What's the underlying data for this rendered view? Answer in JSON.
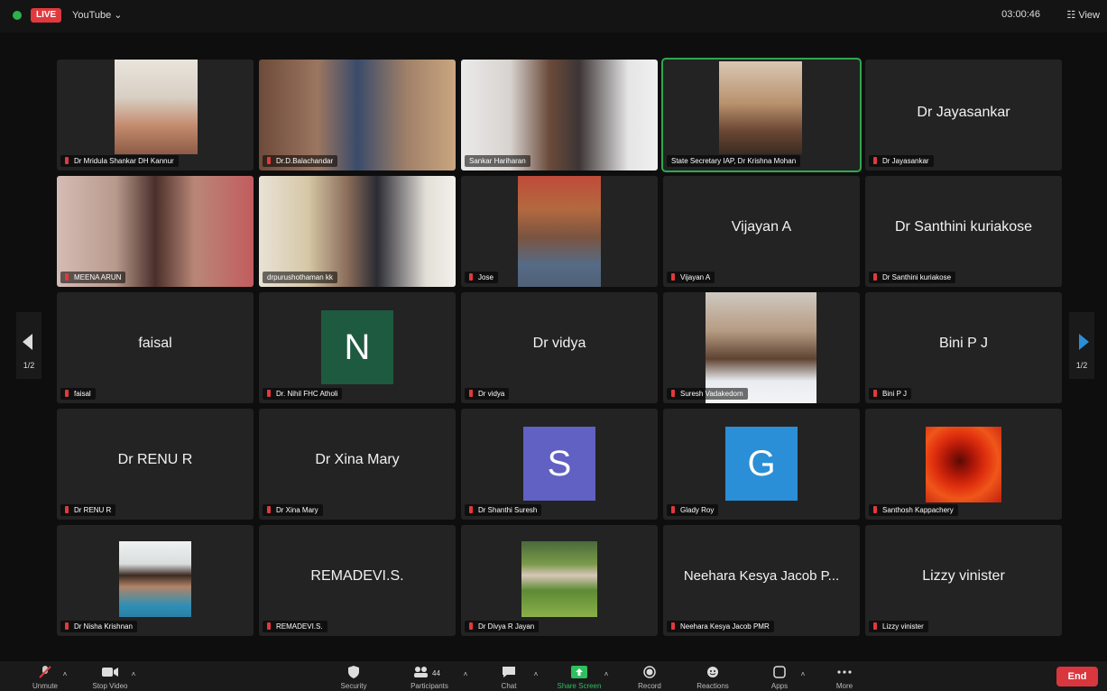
{
  "topbar": {
    "live": "LIVE",
    "platform": "YouTube ⌄",
    "timer": "03:00:46",
    "view": "View"
  },
  "participants": [
    {
      "name": "Dr Mridula Shankar DH Kannur",
      "display": ""
    },
    {
      "name": "Dr.D.Balachandar",
      "display": ""
    },
    {
      "name": "Sankar Hariharan",
      "display": ""
    },
    {
      "name": "State Secretary IAP, Dr Krishna Mohan",
      "display": ""
    },
    {
      "name": "Dr Jayasankar",
      "display": "Dr Jayasankar"
    },
    {
      "name": "MEENA ARUN",
      "display": ""
    },
    {
      "name": "drpurushothaman kk",
      "display": ""
    },
    {
      "name": "Jose",
      "display": ""
    },
    {
      "name": "Vijayan A",
      "display": "Vijayan A"
    },
    {
      "name": "Dr Santhini kuriakose",
      "display": "Dr Santhini kuriakose"
    },
    {
      "name": "faisal",
      "display": "faisal"
    },
    {
      "name": "Dr. Nihil FHC Atholi",
      "display": "",
      "avatar": "N",
      "avatar_color": "#1e5a40"
    },
    {
      "name": "Dr vidya",
      "display": "Dr vidya"
    },
    {
      "name": "Suresh Vadakedom",
      "display": ""
    },
    {
      "name": "Bini P J",
      "display": "Bini P J"
    },
    {
      "name": "Dr RENU R",
      "display": "Dr RENU R"
    },
    {
      "name": "Dr Xina Mary",
      "display": "Dr Xina Mary"
    },
    {
      "name": "Dr Shanthi Suresh",
      "display": "",
      "avatar": "S",
      "avatar_color": "#6160c3"
    },
    {
      "name": "Glady Roy",
      "display": "",
      "avatar": "G",
      "avatar_color": "#2a8fd6"
    },
    {
      "name": "Santhosh Kappachery",
      "display": ""
    },
    {
      "name": "Dr Nisha Krishnan",
      "display": ""
    },
    {
      "name": "REMADEVI.S.",
      "display": "REMADEVI.S."
    },
    {
      "name": "Dr Divya R Jayan",
      "display": ""
    },
    {
      "name": "Neehara Kesya Jacob PMR",
      "display": "Neehara Kesya Jacob P..."
    },
    {
      "name": "Lizzy vinister",
      "display": "Lizzy vinister"
    }
  ],
  "nav": {
    "page": "1/2"
  },
  "toolbar": {
    "unmute": "Unmute",
    "stop_video": "Stop Video",
    "security": "Security",
    "participants": "Participants",
    "participants_count": "44",
    "chat": "Chat",
    "share": "Share Screen",
    "record": "Record",
    "reactions": "Reactions",
    "apps": "Apps",
    "more": "More",
    "end": "End"
  }
}
